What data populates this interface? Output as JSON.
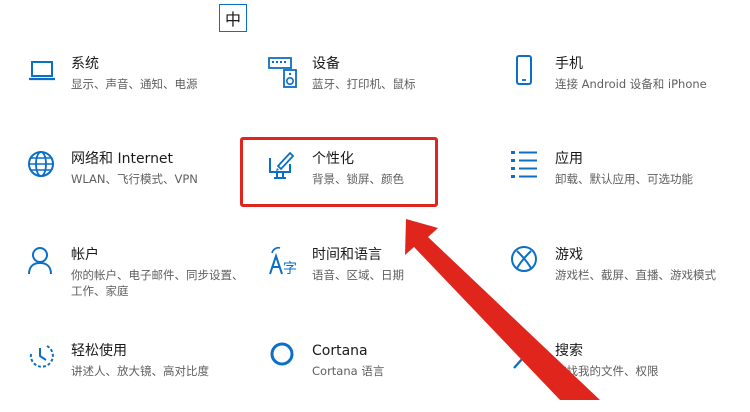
{
  "ime_indicator": "中",
  "accent_color": "#0b6fc7",
  "annotation_color": "#e0261c",
  "tiles": [
    {
      "title": "系统",
      "desc": "显示、声音、通知、电源",
      "icon": "laptop-icon"
    },
    {
      "title": "设备",
      "desc": "蓝牙、打印机、鼠标",
      "icon": "keyboard-speaker-icon"
    },
    {
      "title": "手机",
      "desc": "连接 Android 设备和 iPhone",
      "icon": "phone-icon"
    },
    {
      "title": "网络和 Internet",
      "desc": "WLAN、飞行模式、VPN",
      "icon": "globe-icon"
    },
    {
      "title": "个性化",
      "desc": "背景、锁屏、颜色",
      "icon": "paint-monitor-icon"
    },
    {
      "title": "应用",
      "desc": "卸载、默认应用、可选功能",
      "icon": "apps-list-icon"
    },
    {
      "title": "帐户",
      "desc": "你的帐户、电子邮件、同步设置、工作、家庭",
      "icon": "person-icon"
    },
    {
      "title": "时间和语言",
      "desc": "语音、区域、日期",
      "icon": "time-language-icon"
    },
    {
      "title": "游戏",
      "desc": "游戏栏、截屏、直播、游戏模式",
      "icon": "xbox-icon"
    },
    {
      "title": "轻松使用",
      "desc": "讲述人、放大镜、高对比度",
      "icon": "ease-of-access-icon"
    },
    {
      "title": "Cortana",
      "desc": "Cortana 语言",
      "icon": "cortana-icon"
    },
    {
      "title": "搜索",
      "desc": "查找我的文件、权限",
      "icon": "search-icon"
    }
  ]
}
